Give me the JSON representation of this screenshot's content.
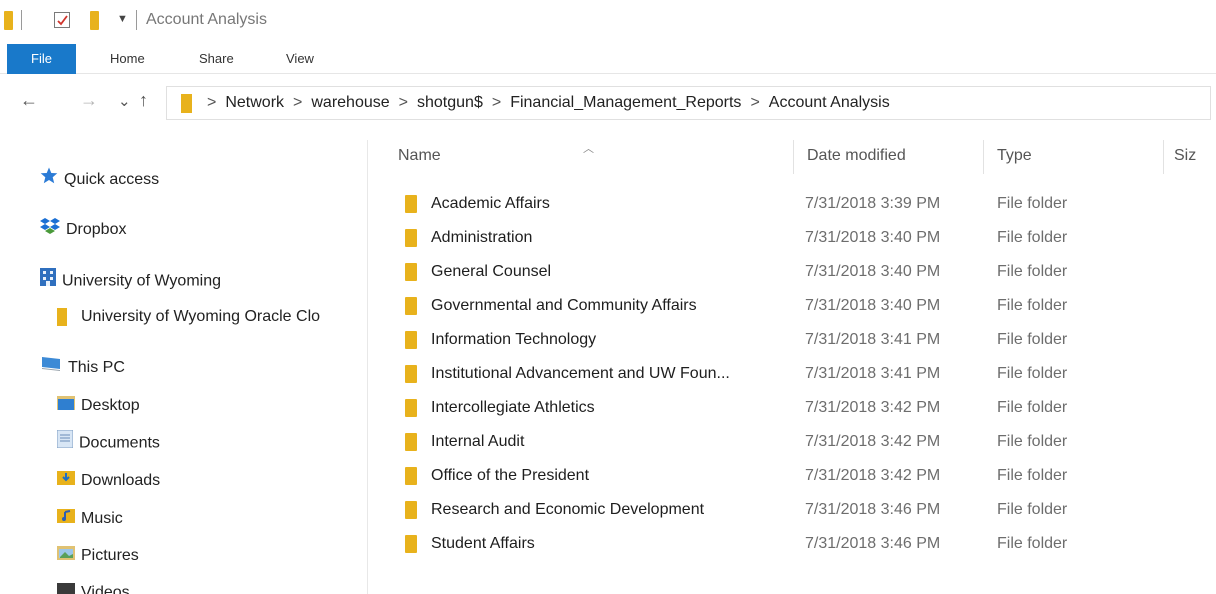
{
  "window": {
    "title": "Account Analysis"
  },
  "ribbon": {
    "tabs": [
      "File",
      "Home",
      "Share",
      "View"
    ]
  },
  "address": {
    "crumbs": [
      "Network",
      "warehouse",
      "shotgun$",
      "Financial_Management_Reports",
      "Account Analysis"
    ],
    "separator": ">"
  },
  "nav": {
    "back_icon": "←",
    "forward_icon": "→",
    "recent_icon": "⌄",
    "up_icon": "↑",
    "items": [
      {
        "label": "Quick access",
        "icon": "star-icon"
      },
      {
        "label": "Dropbox",
        "icon": "dropbox-icon"
      },
      {
        "label": "University of Wyoming",
        "icon": "building-icon"
      },
      {
        "label": "University of Wyoming Oracle Clo",
        "icon": "folder-icon"
      },
      {
        "label": "This PC",
        "icon": "computer-icon"
      },
      {
        "label": "Desktop",
        "icon": "desktop-folder-icon"
      },
      {
        "label": "Documents",
        "icon": "documents-folder-icon"
      },
      {
        "label": "Downloads",
        "icon": "downloads-folder-icon"
      },
      {
        "label": "Music",
        "icon": "music-folder-icon"
      },
      {
        "label": "Pictures",
        "icon": "pictures-folder-icon"
      },
      {
        "label": "Videos",
        "icon": "videos-folder-icon"
      }
    ]
  },
  "columns": {
    "name": "Name",
    "date": "Date modified",
    "type": "Type",
    "size": "Siz"
  },
  "files": [
    {
      "name": "Academic Affairs",
      "date": "7/31/2018 3:39 PM",
      "type": "File folder"
    },
    {
      "name": "Administration",
      "date": "7/31/2018 3:40 PM",
      "type": "File folder"
    },
    {
      "name": "General Counsel",
      "date": "7/31/2018 3:40 PM",
      "type": "File folder"
    },
    {
      "name": "Governmental and Community Affairs",
      "date": "7/31/2018 3:40 PM",
      "type": "File folder"
    },
    {
      "name": "Information Technology",
      "date": "7/31/2018 3:41 PM",
      "type": "File folder"
    },
    {
      "name": "Institutional Advancement and UW Foun...",
      "date": "7/31/2018 3:41 PM",
      "type": "File folder"
    },
    {
      "name": "Intercollegiate Athletics",
      "date": "7/31/2018 3:42 PM",
      "type": "File folder"
    },
    {
      "name": "Internal Audit",
      "date": "7/31/2018 3:42 PM",
      "type": "File folder"
    },
    {
      "name": "Office of the President",
      "date": "7/31/2018 3:42 PM",
      "type": "File folder"
    },
    {
      "name": "Research and Economic Development",
      "date": "7/31/2018 3:46 PM",
      "type": "File folder"
    },
    {
      "name": "Student Affairs",
      "date": "7/31/2018 3:46 PM",
      "type": "File folder"
    }
  ],
  "colors": {
    "accent": "#1979ca",
    "folder": "#e8b21c"
  }
}
